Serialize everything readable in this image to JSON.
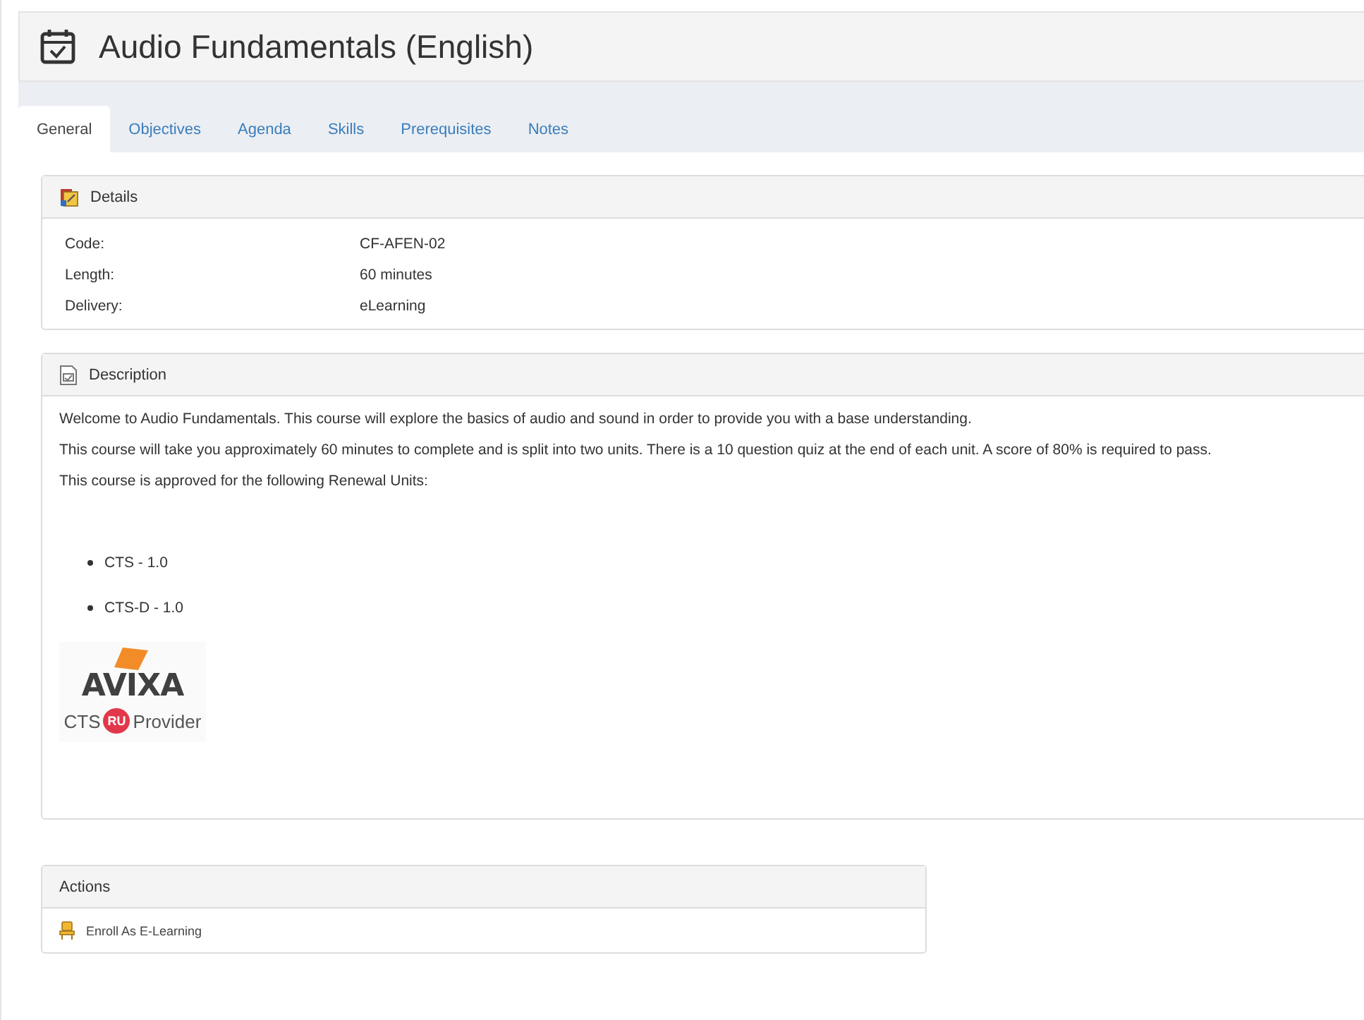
{
  "page": {
    "title": "Audio Fundamentals (English)"
  },
  "tabs": [
    {
      "label": "General",
      "selected": true
    },
    {
      "label": "Objectives",
      "selected": false
    },
    {
      "label": "Agenda",
      "selected": false
    },
    {
      "label": "Skills",
      "selected": false
    },
    {
      "label": "Prerequisites",
      "selected": false
    },
    {
      "label": "Notes",
      "selected": false
    }
  ],
  "details": {
    "title": "Details",
    "rows": [
      {
        "label": "Code:",
        "value": "CF-AFEN-02"
      },
      {
        "label": "Length:",
        "value": "60 minutes"
      },
      {
        "label": "Delivery:",
        "value": "eLearning"
      }
    ]
  },
  "description": {
    "title": "Description",
    "paragraphs": [
      "Welcome to Audio Fundamentals. This course will explore the basics of audio and sound in order to provide you with a base understanding.",
      "This course will take you approximately 60 minutes to complete and is split into two units. There is a 10 question quiz at the end of each unit. A score of 80% is required to pass.",
      "This course is approved for the following Renewal Units:"
    ],
    "units": [
      "CTS - 1.0",
      "CTS-D - 1.0"
    ],
    "logo": {
      "name": "AVIXA",
      "prefix": "CTS",
      "badge": "RU",
      "suffix": "Provider"
    }
  },
  "actions": {
    "title": "Actions",
    "items": [
      "Enroll As E-Learning"
    ]
  }
}
